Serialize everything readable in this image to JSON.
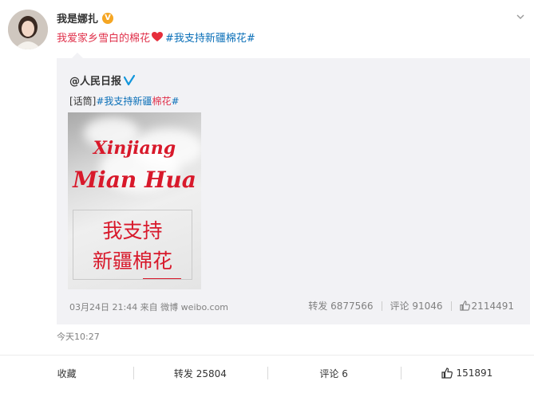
{
  "post": {
    "username": "我是娜扎",
    "badge": "V",
    "text_main": "我爱家乡雪白的棉花",
    "text_tag": "#我支持新疆棉花#",
    "time": "今天10:27"
  },
  "repost": {
    "author": "@人民日报",
    "text_prefix": "[话筒]",
    "text_tag_a": "#我支持新疆",
    "text_tag_b": "棉花",
    "text_tag_c": "#",
    "image": {
      "line1": "Xinjiang",
      "line2": "Mian Hua",
      "cn_line1": "我支持",
      "cn_line2": "新疆棉花"
    },
    "meta": "03月24日 21:44 来自 微博 weibo.com",
    "stats": {
      "forward": "转发 6877566",
      "comment": "评论 91046",
      "like": "2114491"
    }
  },
  "actions": {
    "favorite": "收藏",
    "forward": "转发 25804",
    "comment": "评论 6",
    "like": "151891"
  },
  "colors": {
    "accent_red": "#e0314b",
    "link_blue": "#0a6fb8",
    "vip_orange": "#f5a623"
  },
  "icons": [
    "avatar",
    "vip-badge-icon",
    "chevron-down-icon",
    "heart-icon",
    "verified-blue-icon",
    "thumb-up-icon"
  ]
}
